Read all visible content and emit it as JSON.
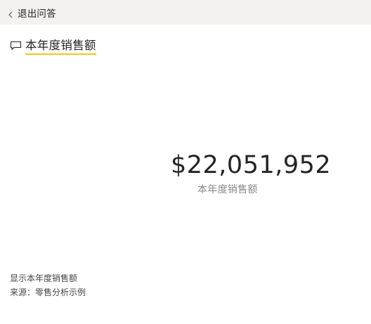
{
  "header": {
    "back_label": "退出问答",
    "back_icon": "chevron-left-icon"
  },
  "question": {
    "text": "本年度销售额",
    "icon": "chat-bubble-icon",
    "underline_color": "#f2c811"
  },
  "card": {
    "value": "$22,051,952",
    "label": "本年度销售额"
  },
  "footer": {
    "description": "显示本年度销售额",
    "source": "来源：零售分析示例"
  },
  "colors": {
    "topbar_background": "#f3f2f1",
    "text": "#252423",
    "secondary_text": "#8a8886"
  }
}
